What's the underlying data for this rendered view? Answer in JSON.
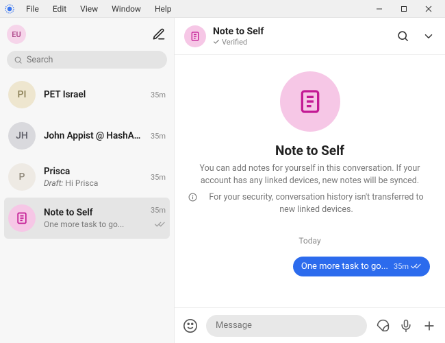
{
  "menu": {
    "file": "File",
    "edit": "Edit",
    "view": "View",
    "window": "Window",
    "help": "Help"
  },
  "sidebar": {
    "me_initials": "EU",
    "search_placeholder": "Search",
    "items": [
      {
        "initials": "PI",
        "name": "PET Israel",
        "snippet": "",
        "time": "35m"
      },
      {
        "initials": "JH",
        "name": "John Appist @ HashAnal...",
        "snippet": "",
        "time": "35m"
      },
      {
        "initials": "P",
        "name": "Prisca",
        "draft_label": "Draft:",
        "snippet": "Hi Prisca",
        "time": "35m"
      },
      {
        "initials": "",
        "name": "Note to Self",
        "snippet": "One more task to go...",
        "time": "35m"
      }
    ]
  },
  "conversation": {
    "title": "Note to Self",
    "verified": "Verified",
    "big_title": "Note to Self",
    "info": "You can add notes for yourself in this conversation. If your account has any linked devices, new notes will be synced.",
    "security": "For your security, conversation history isn't transferred to new linked devices.",
    "date": "Today",
    "message_text": "One more task to go...",
    "message_time": "35m"
  },
  "composer": {
    "placeholder": "Message"
  }
}
